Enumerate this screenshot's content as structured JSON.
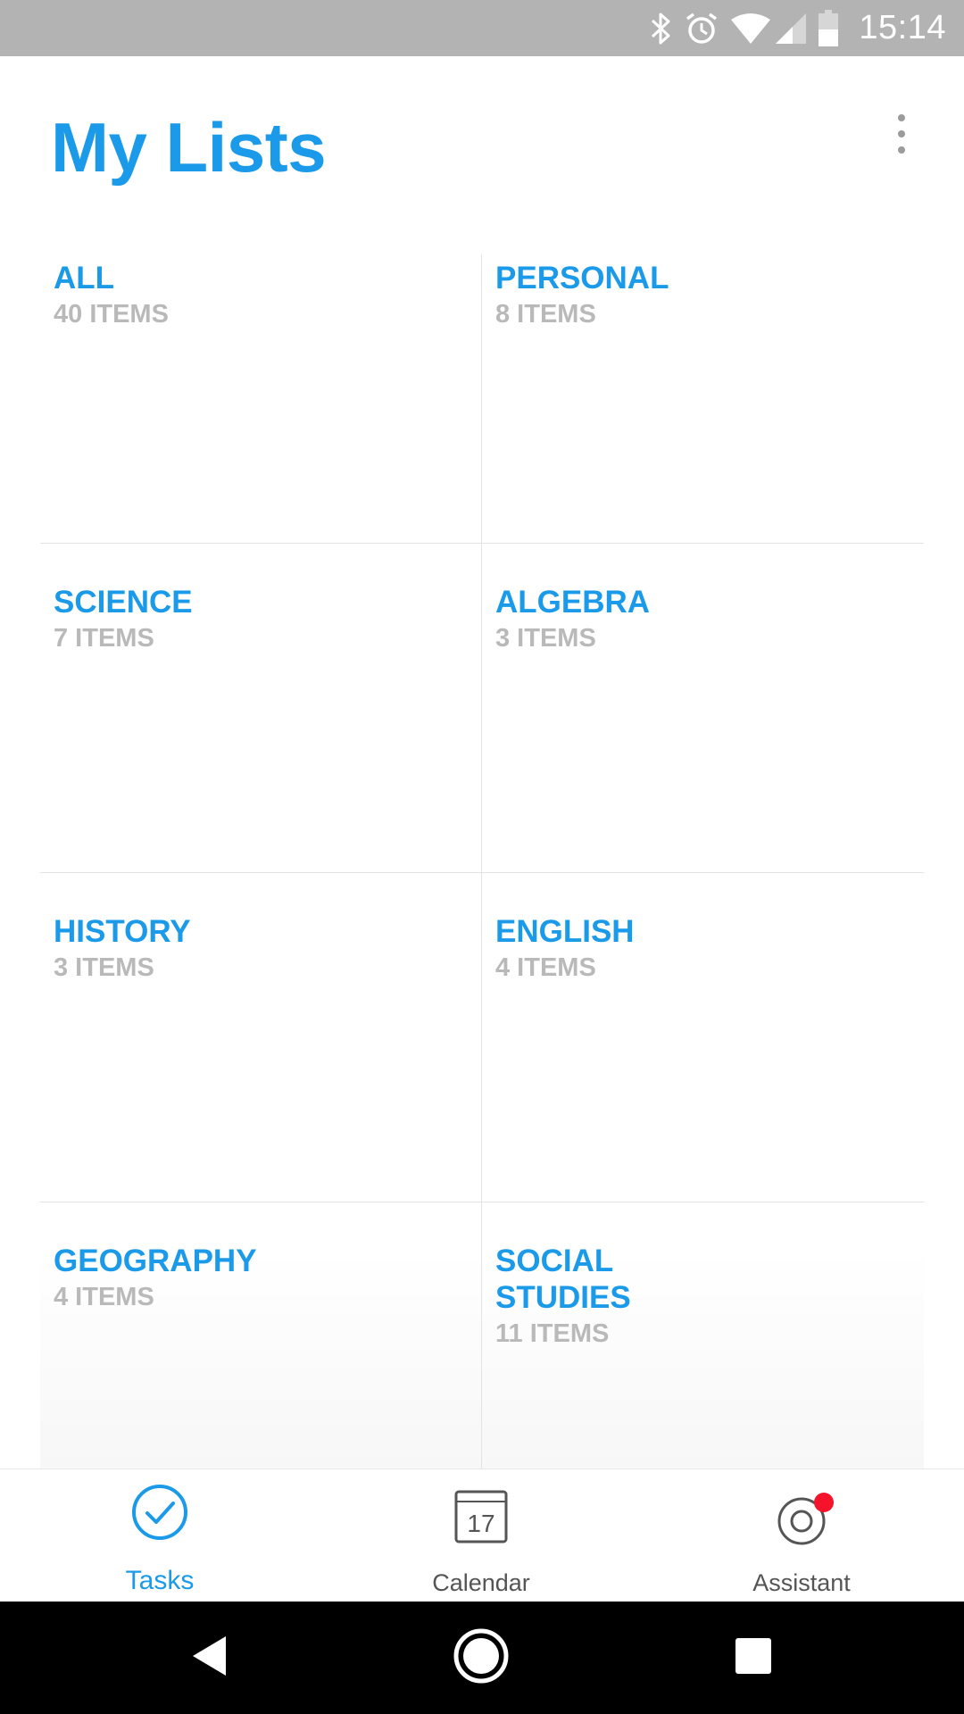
{
  "status_bar": {
    "time": "15:14",
    "icons": [
      "bluetooth-icon",
      "alarm-icon",
      "wifi-icon",
      "cell-signal-icon",
      "battery-icon"
    ]
  },
  "header": {
    "title": "My Lists",
    "menu_icon": "more-vertical-icon"
  },
  "lists": [
    {
      "name": "ALL",
      "count": "40 ITEMS"
    },
    {
      "name": "PERSONAL",
      "count": "8 ITEMS"
    },
    {
      "name": "SCIENCE",
      "count": "7 ITEMS"
    },
    {
      "name": "ALGEBRA",
      "count": "3 ITEMS"
    },
    {
      "name": "HISTORY",
      "count": "3 ITEMS"
    },
    {
      "name": "ENGLISH",
      "count": "4 ITEMS"
    },
    {
      "name": "GEOGRAPHY",
      "count": "4 ITEMS"
    },
    {
      "name": "SOCIAL STUDIES",
      "count": "11 ITEMS"
    }
  ],
  "bottom_nav": [
    {
      "label": "Tasks",
      "icon": "check-circle-icon",
      "active": true
    },
    {
      "label": "Calendar",
      "icon": "calendar-icon",
      "calendar_day": "17"
    },
    {
      "label": "Assistant",
      "icon": "assistant-icon",
      "badge": true
    }
  ],
  "system_nav": [
    "back-icon",
    "home-icon",
    "recents-icon"
  ],
  "colors": {
    "accent": "#1a9ae8",
    "muted_text": "#b9b9b9",
    "status_bar": "#b3b3b3",
    "badge": "#f5122b"
  }
}
